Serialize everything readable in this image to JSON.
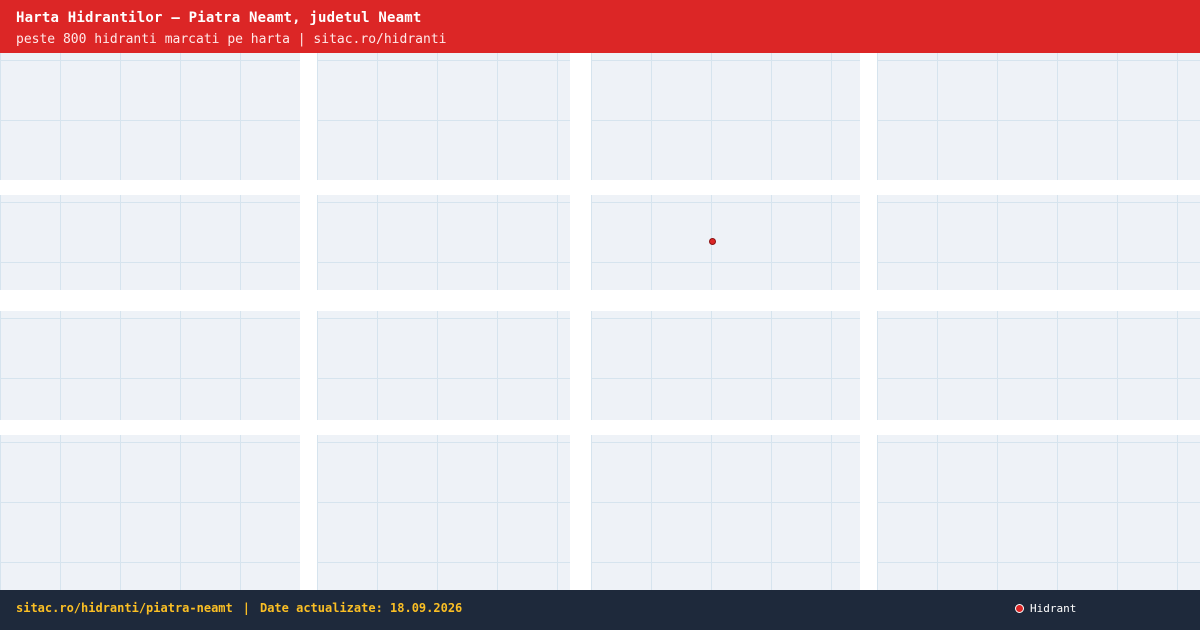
{
  "header": {
    "title": "Harta Hidrantilor — Piatra Neamt, judetul Neamt",
    "subtitle": "peste 800 hidranti marcati pe harta | sitac.ro/hidranti"
  },
  "map": {
    "markers": [
      {
        "type": "hydrant"
      }
    ]
  },
  "footer": {
    "url": "sitac.ro/hidranti/piatra-neamt",
    "separator": "|",
    "update_text": "Date actualizate: 18.09.2026"
  },
  "legend": {
    "label": "Hidrant",
    "color": "#dc2626"
  },
  "colors": {
    "header_bg": "#dc2626",
    "footer_bg": "#1e293b",
    "footer_text": "#fbbf24",
    "block_bg": "#eef2f7",
    "road": "#ffffff"
  }
}
